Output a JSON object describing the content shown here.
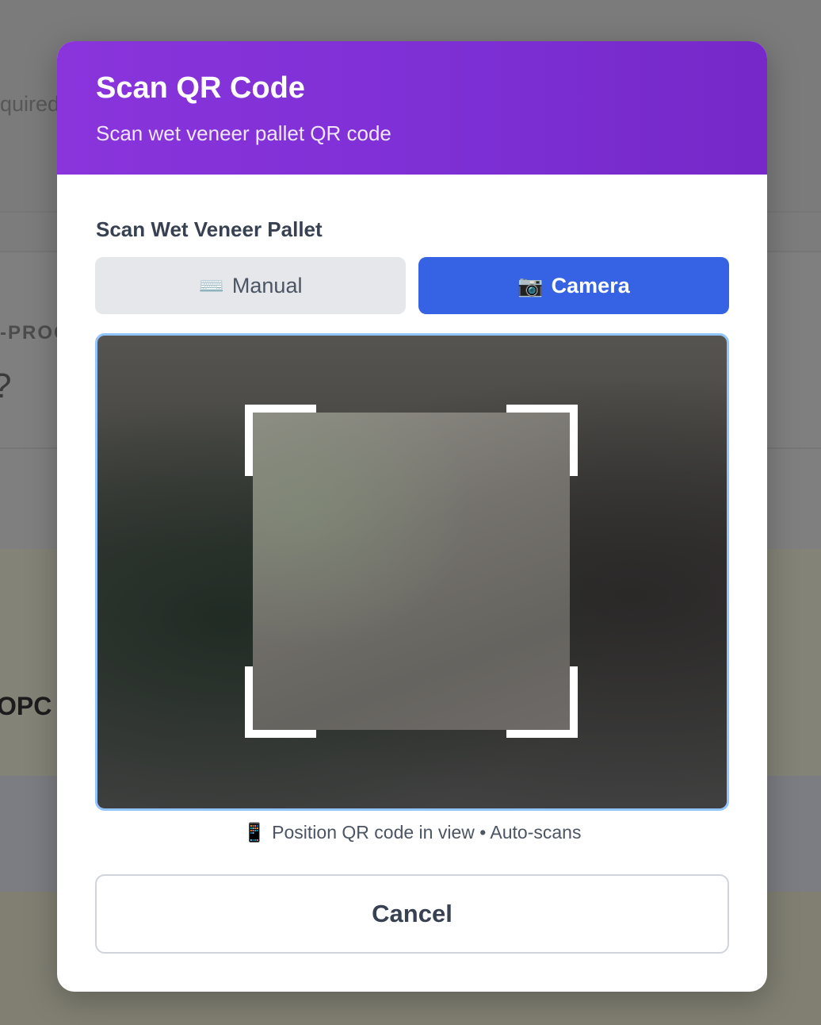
{
  "background": {
    "required_fragment": "quired",
    "in_progress_fragment": "-PROG",
    "partial_value": "?",
    "code_fragment": "OPC"
  },
  "modal": {
    "title": "Scan QR Code",
    "subtitle": "Scan wet veneer pallet QR code",
    "section_label": "Scan Wet Veneer Pallet",
    "modes": {
      "manual": {
        "icon": "⌨️",
        "icon_name": "keyboard-icon",
        "label": "Manual",
        "active": false
      },
      "camera": {
        "icon": "📷",
        "icon_name": "camera-icon",
        "label": "Camera",
        "active": true
      }
    },
    "hint": {
      "icon": "📱",
      "icon_name": "mobile-phone-icon",
      "text": "Position QR code in view • Auto-scans"
    },
    "cancel_label": "Cancel"
  },
  "colors": {
    "header_gradient_start": "#8a34dc",
    "header_gradient_end": "#7628c8",
    "camera_active": "#3563e4",
    "manual_inactive": "#e5e7eb",
    "scanner_border": "#93c5fd"
  }
}
